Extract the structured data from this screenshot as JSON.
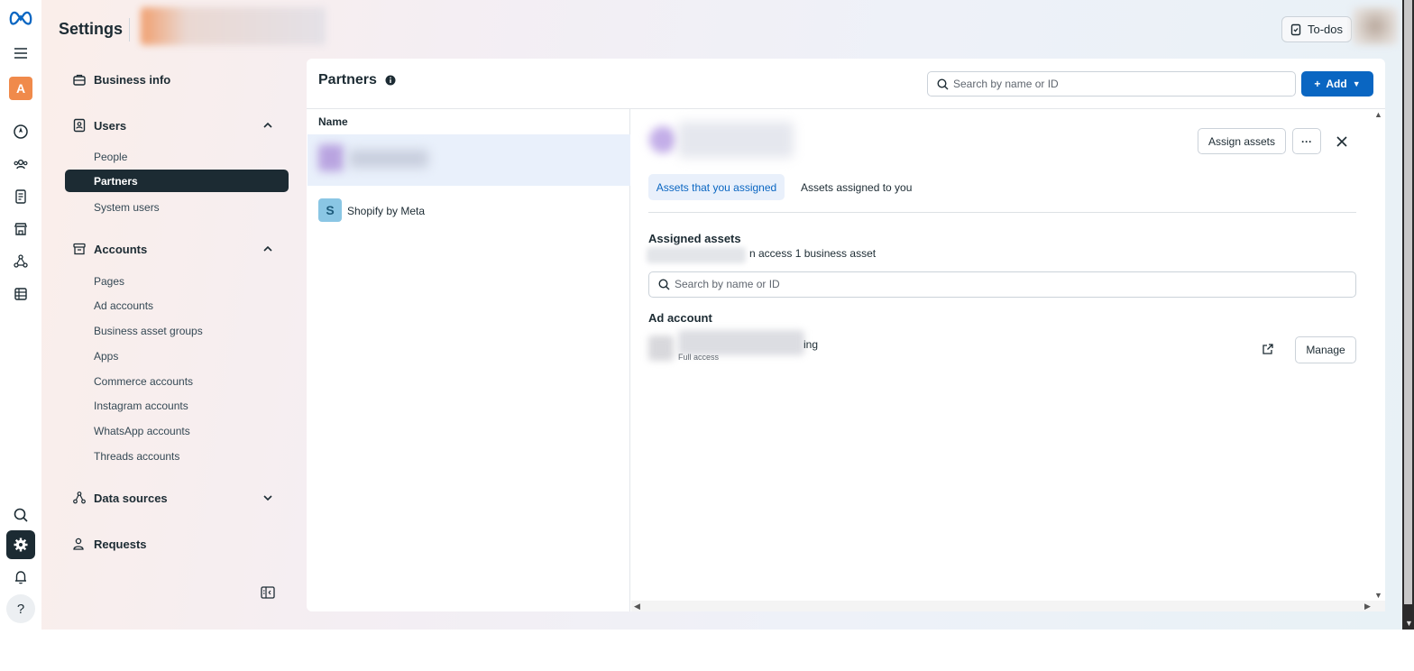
{
  "header": {
    "title": "Settings",
    "todos_label": "To-dos"
  },
  "rail": {
    "avatar_letter": "A",
    "help_label": "?",
    "icons": [
      "meta-logo-icon",
      "menu-icon",
      "compass-icon",
      "people-icon",
      "document-icon",
      "store-icon",
      "network-icon",
      "catalog-icon",
      "search-icon",
      "gear-icon",
      "bell-icon",
      "help-icon"
    ]
  },
  "sidebar": {
    "business_info": "Business info",
    "users": {
      "label": "Users",
      "items": [
        "People",
        "Partners",
        "System users"
      ]
    },
    "accounts": {
      "label": "Accounts",
      "items": [
        "Pages",
        "Ad accounts",
        "Business asset groups",
        "Apps",
        "Commerce accounts",
        "Instagram accounts",
        "WhatsApp accounts",
        "Threads accounts"
      ]
    },
    "data_sources": "Data sources",
    "requests": "Requests"
  },
  "partners": {
    "title": "Partners",
    "search_placeholder": "Search by name or ID",
    "add_label": "Add",
    "column_name": "Name",
    "rows": [
      {
        "avatar": "S",
        "name": "Shopify by Meta"
      }
    ]
  },
  "detail": {
    "assign_label": "Assign assets",
    "more_label": "···",
    "tabs": [
      "Assets that you assigned",
      "Assets assigned to you"
    ],
    "assigned_title": "Assigned assets",
    "assigned_subtitle": "n access 1 business asset",
    "search_placeholder": "Search by name or ID",
    "ad_account_title": "Ad account",
    "asset_name_suffix": "ing",
    "asset_access": "Full access",
    "manage_label": "Manage"
  },
  "colors": {
    "accent": "#0a66c2",
    "active_nav": "#1c2b33",
    "avatar_orange": "#f08a4b",
    "selected_row": "#e9f0fb"
  }
}
